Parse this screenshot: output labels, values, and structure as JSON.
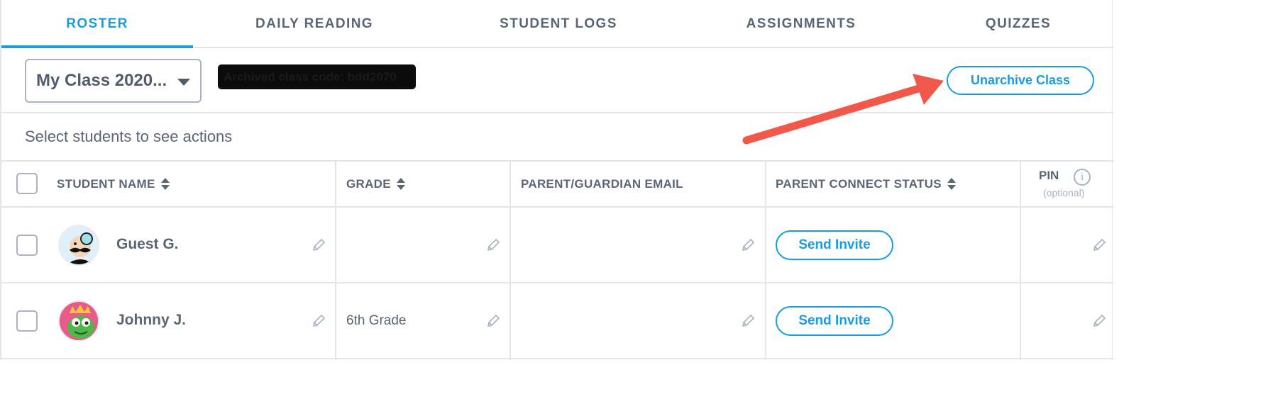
{
  "tabs": [
    {
      "label": "ROSTER",
      "active": true
    },
    {
      "label": "DAILY READING",
      "active": false
    },
    {
      "label": "STUDENT LOGS",
      "active": false
    },
    {
      "label": "ASSIGNMENTS",
      "active": false
    },
    {
      "label": "QUIZZES",
      "active": false
    }
  ],
  "toolbar": {
    "class_select_value": "My Class 2020...",
    "archived_code_text": "Archived class code: bdd2070",
    "unarchive_label": "Unarchive Class"
  },
  "helper_text": "Select students to see actions",
  "table": {
    "headers": {
      "student_name": "STUDENT NAME",
      "grade": "GRADE",
      "parent_email": "PARENT/GUARDIAN EMAIL",
      "parent_status": "PARENT CONNECT STATUS",
      "pin": "PIN",
      "pin_optional": "(optional)",
      "pin_info": "i"
    },
    "rows": [
      {
        "name": "Guest G.",
        "grade": "",
        "email": "",
        "status_action": "Send Invite",
        "pin": ""
      },
      {
        "name": "Johnny J.",
        "grade": "6th Grade",
        "email": "",
        "status_action": "Send Invite",
        "pin": ""
      }
    ]
  },
  "colors": {
    "accent": "#1a9ce0",
    "text": "#5b6574",
    "border": "#e3e7ec",
    "annotation_arrow": "#f2584a"
  },
  "icons": {
    "sort": "sort-icon",
    "edit": "pencil-icon",
    "info": "info-icon",
    "dropdown": "caret-down-icon"
  }
}
